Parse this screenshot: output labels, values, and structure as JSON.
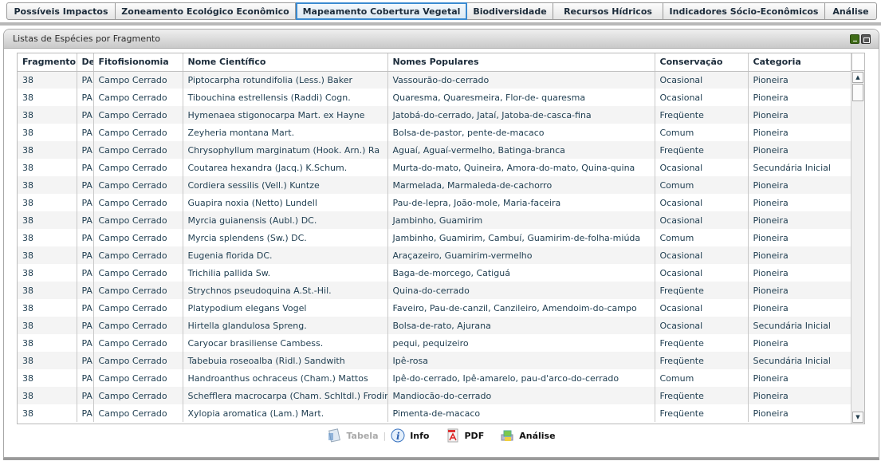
{
  "tabs": [
    {
      "label": "Possíveis Impactos",
      "active": false
    },
    {
      "label": "Zoneamento Ecológico Econômico",
      "active": false
    },
    {
      "label": "Mapeamento Cobertura Vegetal",
      "active": true
    },
    {
      "label": "Biodiversidade",
      "active": false
    },
    {
      "label": "Recursos Hídricos",
      "active": false
    },
    {
      "label": "Indicadores Sócio-Econômicos",
      "active": false
    },
    {
      "label": "Análise",
      "active": false
    }
  ],
  "panel": {
    "title": "Listas de Espécies por Fragmento",
    "icons": [
      "minimize-icon",
      "restore-icon"
    ]
  },
  "table": {
    "columns": [
      "Fragmento",
      "De",
      "Fitofisionomia",
      "Nome Científico",
      "Nomes Populares",
      "Conservação",
      "Categoria"
    ],
    "rows": [
      [
        "38",
        "PA",
        "Campo Cerrado",
        "Piptocarpha rotundifolia (Less.) Baker",
        "Vassourão-do-cerrado",
        "Ocasional",
        "Pioneira"
      ],
      [
        "38",
        "PA",
        "Campo Cerrado",
        "Tibouchina estrellensis (Raddi) Cogn.",
        "Quaresma, Quaresmeira, Flor-de- quaresma",
        "Ocasional",
        "Pioneira"
      ],
      [
        "38",
        "PA",
        "Campo Cerrado",
        "Hymenaea stigonocarpa Mart. ex Hayne",
        "Jatobá-do-cerrado, Jataí, Jatoba-de-casca-fina",
        "Freqüente",
        "Pioneira"
      ],
      [
        "38",
        "PA",
        "Campo Cerrado",
        "Zeyheria montana Mart.",
        "Bolsa-de-pastor, pente-de-macaco",
        "Comum",
        "Pioneira"
      ],
      [
        "38",
        "PA",
        "Campo Cerrado",
        "Chrysophyllum marginatum (Hook.  Arn.) Ra",
        "Aguaí, Aguaí-vermelho, Batinga-branca",
        "Freqüente",
        "Pioneira"
      ],
      [
        "38",
        "PA",
        "Campo Cerrado",
        "Coutarea hexandra (Jacq.) K.Schum.",
        "Murta-do-mato, Quineira, Amora-do-mato, Quina-quina",
        "Ocasional",
        "Secundária Inicial"
      ],
      [
        "38",
        "PA",
        "Campo Cerrado",
        "Cordiera sessilis (Vell.) Kuntze",
        "Marmelada, Marmaleda-de-cachorro",
        "Comum",
        "Pioneira"
      ],
      [
        "38",
        "PA",
        "Campo Cerrado",
        "Guapira noxia (Netto) Lundell",
        "Pau-de-lepra, João-mole, Maria-faceira",
        "Ocasional",
        "Pioneira"
      ],
      [
        "38",
        "PA",
        "Campo Cerrado",
        "Myrcia guianensis (Aubl.) DC.",
        "Jambinho, Guamirim",
        "Ocasional",
        "Pioneira"
      ],
      [
        "38",
        "PA",
        "Campo Cerrado",
        "Myrcia splendens (Sw.) DC.",
        "Jambinho, Guamirim, Cambuí, Guamirim-de-folha-miúda",
        "Comum",
        "Pioneira"
      ],
      [
        "38",
        "PA",
        "Campo Cerrado",
        "Eugenia florida DC.",
        "Araçazeiro, Guamirim-vermelho",
        "Ocasional",
        "Pioneira"
      ],
      [
        "38",
        "PA",
        "Campo Cerrado",
        "Trichilia pallida Sw.",
        "Baga-de-morcego, Catiguá",
        "Ocasional",
        "Pioneira"
      ],
      [
        "38",
        "PA",
        "Campo Cerrado",
        "Strychnos pseudoquina A.St.-Hil.",
        "Quina-do-cerrado",
        "Freqüente",
        "Pioneira"
      ],
      [
        "38",
        "PA",
        "Campo Cerrado",
        "Platypodium elegans Vogel",
        "Faveiro, Pau-de-canzil, Canzileiro, Amendoim-do-campo",
        "Ocasional",
        "Pioneira"
      ],
      [
        "38",
        "PA",
        "Campo Cerrado",
        "Hirtella glandulosa Spreng.",
        "Bolsa-de-rato, Ajurana",
        "Ocasional",
        "Secundária Inicial"
      ],
      [
        "38",
        "PA",
        "Campo Cerrado",
        "Caryocar brasiliense Cambess.",
        "pequi, pequizeiro",
        "Freqüente",
        "Pioneira"
      ],
      [
        "38",
        "PA",
        "Campo Cerrado",
        "Tabebuia roseoalba (Ridl.) Sandwith",
        "Ipê-rosa",
        "Freqüente",
        "Secundária Inicial"
      ],
      [
        "38",
        "PA",
        "Campo Cerrado",
        "Handroanthus ochraceus (Cham.) Mattos",
        "Ipê-do-cerrado, Ipê-amarelo, pau-d'arco-do-cerrado",
        "Comum",
        "Pioneira"
      ],
      [
        "38",
        "PA",
        "Campo Cerrado",
        "Schefflera macrocarpa (Cham.  Schltdl.) Frodin",
        "Mandiocão-do-cerrado",
        "Freqüente",
        "Pioneira"
      ],
      [
        "38",
        "PA",
        "Campo Cerrado",
        "Xylopia aromatica (Lam.) Mart.",
        "Pimenta-de-macaco",
        "Freqüente",
        "Pioneira"
      ]
    ]
  },
  "footer": {
    "tabela": "Tabela",
    "info": "Info",
    "pdf": "PDF",
    "analise": "Análise"
  }
}
